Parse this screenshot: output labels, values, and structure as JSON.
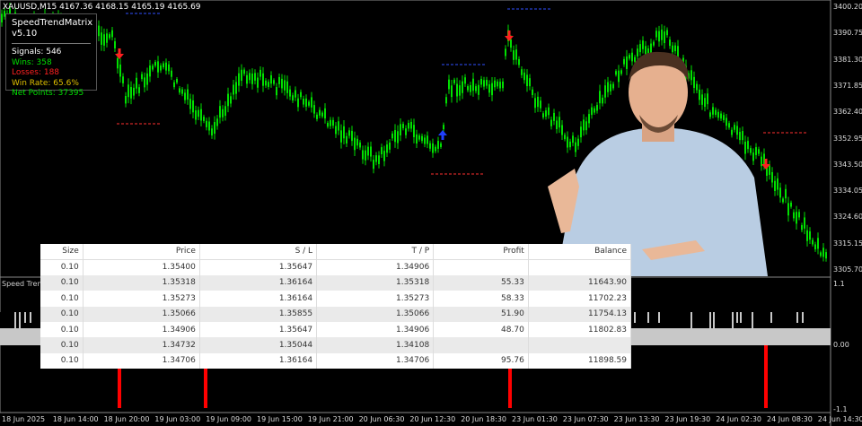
{
  "chart": {
    "symbol_line": "XAUUSD,M15  4167.36 4168.15 4165.19 4165.69",
    "indicator_label": "Speed Trend",
    "price_axis": [
      "3400.20",
      "3390.75",
      "3381.30",
      "3371.85",
      "3362.40",
      "3352.95",
      "3343.50",
      "3334.05",
      "3324.60",
      "3315.15",
      "3305.70"
    ],
    "indicator_axis": [
      "1.1",
      "0.00",
      "-1.1"
    ],
    "time_axis": [
      "18 Jun 2025",
      "18 Jun 14:00",
      "18 Jun 20:00",
      "19 Jun 03:00",
      "19 Jun 09:00",
      "19 Jun 15:00",
      "19 Jun 21:00",
      "20 Jun 06:30",
      "20 Jun 12:30",
      "20 Jun 18:30",
      "23 Jun 01:30",
      "23 Jun 07:30",
      "23 Jun 13:30",
      "23 Jun 19:30",
      "24 Jun 02:30",
      "24 Jun 08:30",
      "24 Jun 14:30"
    ],
    "colors": {
      "bull": "#00e000",
      "sell_arrow": "#ff2020",
      "buy_arrow": "#2040ff",
      "signal_bar": "#ff0000"
    }
  },
  "panel": {
    "title": "SpeedTrendMatrix v5.10",
    "signals": "Signals: 546",
    "wins": "Wins: 358",
    "losses": "Losses: 188",
    "win_rate": "Win Rate: 65.6%",
    "net_points": "Net Points: 37395"
  },
  "table": {
    "headers": [
      "Size",
      "Price",
      "S / L",
      "T / P",
      "Profit",
      "Balance"
    ],
    "rows": [
      [
        "0.10",
        "1.35400",
        "1.35647",
        "1.34906",
        "",
        ""
      ],
      [
        "0.10",
        "1.35318",
        "1.36164",
        "1.35318",
        "55.33",
        "11643.90"
      ],
      [
        "0.10",
        "1.35273",
        "1.36164",
        "1.35273",
        "58.33",
        "11702.23"
      ],
      [
        "0.10",
        "1.35066",
        "1.35855",
        "1.35066",
        "51.90",
        "11754.13"
      ],
      [
        "0.10",
        "1.34906",
        "1.35647",
        "1.34906",
        "48.70",
        "11802.83"
      ],
      [
        "0.10",
        "1.34732",
        "1.35044",
        "1.34108",
        "",
        ""
      ],
      [
        "0.10",
        "1.34706",
        "1.36164",
        "1.34706",
        "95.76",
        "11898.59"
      ]
    ]
  }
}
